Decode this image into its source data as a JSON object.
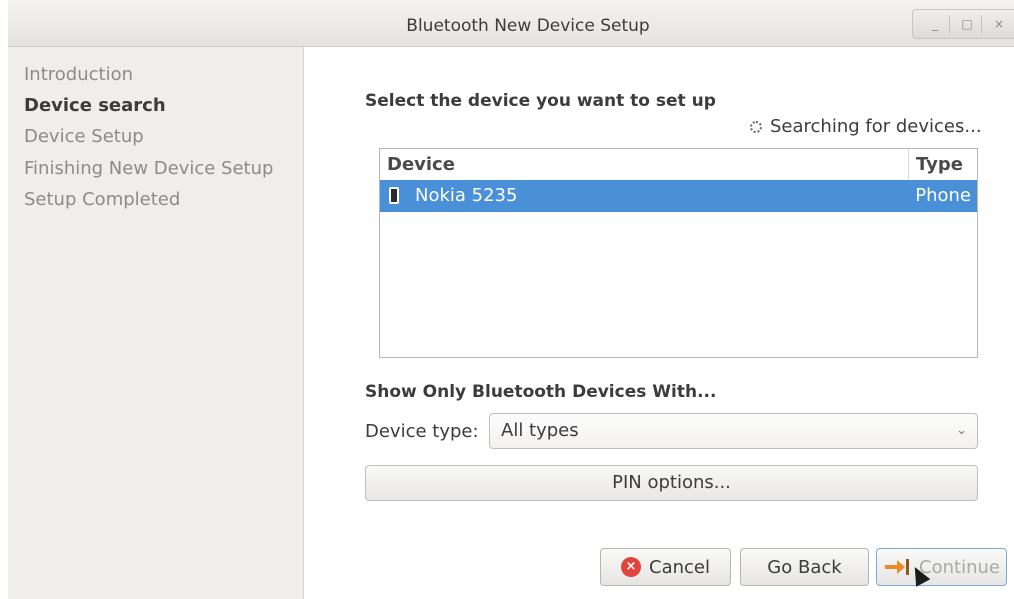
{
  "window": {
    "title": "Bluetooth New Device Setup",
    "controls": [
      "minimize",
      "maximize",
      "close"
    ]
  },
  "sidebar": {
    "steps": [
      {
        "label": "Introduction",
        "state": "done"
      },
      {
        "label": "Device search",
        "state": "active"
      },
      {
        "label": "Device Setup",
        "state": "pending"
      },
      {
        "label": "Finishing New Device Setup",
        "state": "pending"
      },
      {
        "label": "Setup Completed",
        "state": "pending"
      }
    ]
  },
  "main": {
    "heading": "Select the device you want to set up",
    "status": "Searching for devices...",
    "device_list": {
      "columns": [
        "Device",
        "Type"
      ],
      "rows": [
        {
          "icon": "phone-icon",
          "name": "Nokia 5235",
          "type": "Phone",
          "selected": true
        }
      ]
    },
    "filter": {
      "heading": "Show Only Bluetooth Devices With...",
      "device_type_label": "Device type:",
      "device_type_value": "All types"
    },
    "pin_button": "PIN options..."
  },
  "footer": {
    "cancel": "Cancel",
    "back": "Go Back",
    "continue": "Continue"
  },
  "colors": {
    "selection": "#4a90d9",
    "sidebar_bg": "#efeeed",
    "cancel_icon": "#e0443d",
    "continue_icon": "#f08a24"
  }
}
